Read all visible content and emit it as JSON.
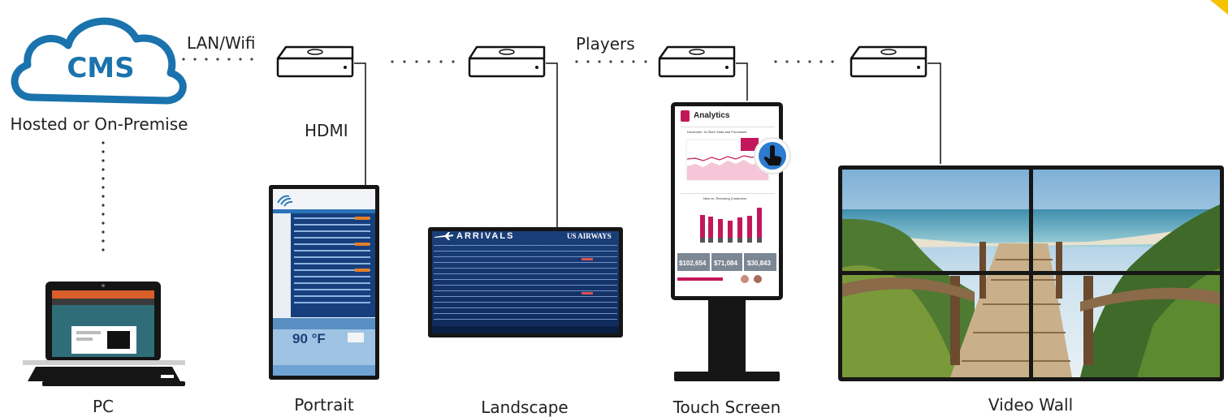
{
  "cms": {
    "logo_text": "CMS",
    "caption": "Hosted or On-Premise"
  },
  "connections": {
    "network_label": "LAN/Wifi",
    "cable_label": "HDMI",
    "players_label": "Players"
  },
  "devices": {
    "pc": {
      "caption": "PC"
    },
    "portrait": {
      "caption": "Portrait",
      "weather_temp": "90 °F"
    },
    "landscape": {
      "caption": "Landscape",
      "board_title": "ARRIVALS",
      "airline": "US AIRWAYS"
    },
    "touch": {
      "caption": "Touch Screen",
      "app_title": "Analytics",
      "chart_title": "December: In-Store Visits and Purchases",
      "bar_title": "New vs. Returning Customers",
      "kpis": [
        "$102,654",
        "$71,084",
        "$30,843"
      ]
    },
    "wall": {
      "caption": "Video Wall"
    }
  },
  "colors": {
    "cms_blue": "#1a73ad",
    "screen_navy": "#0f2f66",
    "touch_pink": "#c2185b",
    "accent_yellow": "#f5c200"
  }
}
